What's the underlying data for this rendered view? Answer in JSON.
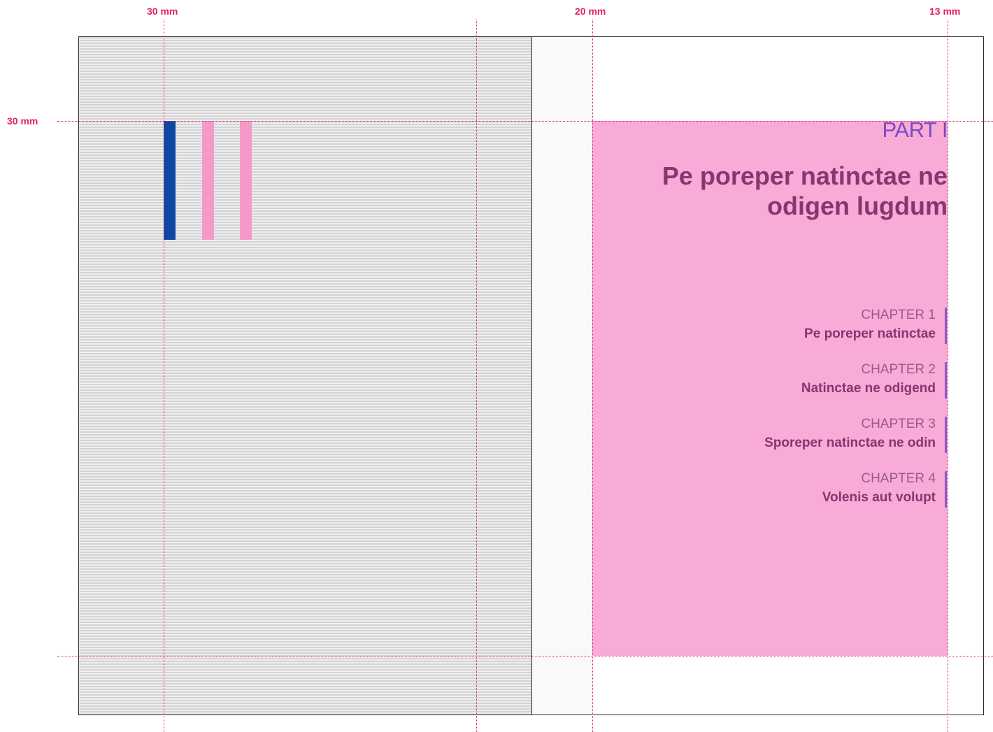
{
  "measurements": {
    "top_outer_left": "30 mm",
    "top_inner_right": "20 mm",
    "top_outer_right": "13 mm",
    "side_top": "30 mm"
  },
  "colors": {
    "guide": "#e0245e",
    "text_block": "#f7abd6",
    "bar_blue": "#0d47a1",
    "bar_pink": "#f59ac8",
    "title": "#8a3470",
    "part": "#7b4bc4",
    "chapter_rule": "#8a5bc4"
  },
  "part": {
    "label": "PART I",
    "title": "Pe poreper natinctae ne odigen lugdum"
  },
  "chapters": [
    {
      "number": "CHAPTER 1",
      "title": "Pe poreper natinctae"
    },
    {
      "number": "CHAPTER 2",
      "title": "Natinctae ne odigend"
    },
    {
      "number": "CHAPTER 3",
      "title": "Sporeper natinctae ne odin"
    },
    {
      "number": "CHAPTER 4",
      "title": "Volenis aut volupt"
    }
  ]
}
